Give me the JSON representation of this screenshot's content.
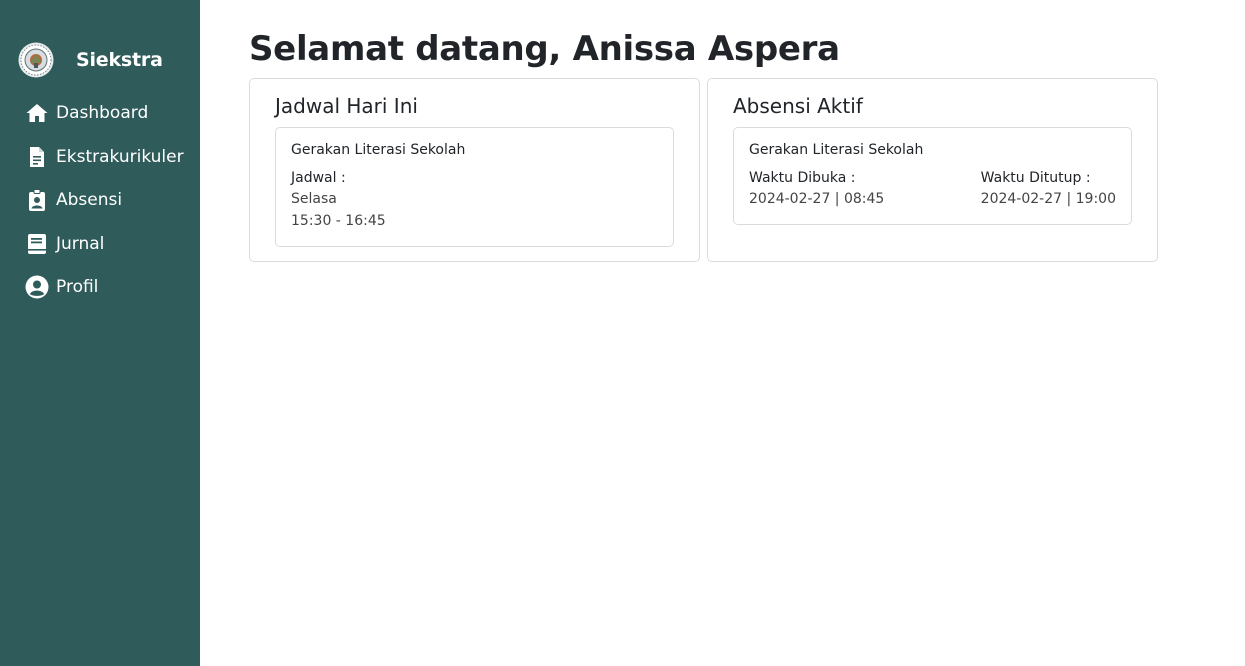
{
  "brand": {
    "name": "Siekstra"
  },
  "sidebar": {
    "items": [
      {
        "label": "Dashboard",
        "icon": "home-icon"
      },
      {
        "label": "Ekstrakurikuler",
        "icon": "document-icon"
      },
      {
        "label": "Absensi",
        "icon": "clipboard-user-icon"
      },
      {
        "label": "Jurnal",
        "icon": "book-icon"
      },
      {
        "label": "Profil",
        "icon": "user-circle-icon"
      }
    ]
  },
  "page": {
    "title": "Selamat datang, Anissa Aspera"
  },
  "schedule_card": {
    "title": "Jadwal Hari Ini",
    "event": "Gerakan Literasi Sekolah",
    "label": "Jadwal :",
    "day": "Selasa",
    "time": "15:30 - 16:45"
  },
  "attendance_card": {
    "title": "Absensi Aktif",
    "event": "Gerakan Literasi Sekolah",
    "open_label": "Waktu Dibuka :",
    "open_value": "2024-02-27 | 08:45",
    "close_label": "Waktu Ditutup :",
    "close_value": "2024-02-27 | 19:00"
  },
  "colors": {
    "sidebar_bg": "#2f5b5a",
    "text": "#212529",
    "border": "#d9dcdf"
  }
}
